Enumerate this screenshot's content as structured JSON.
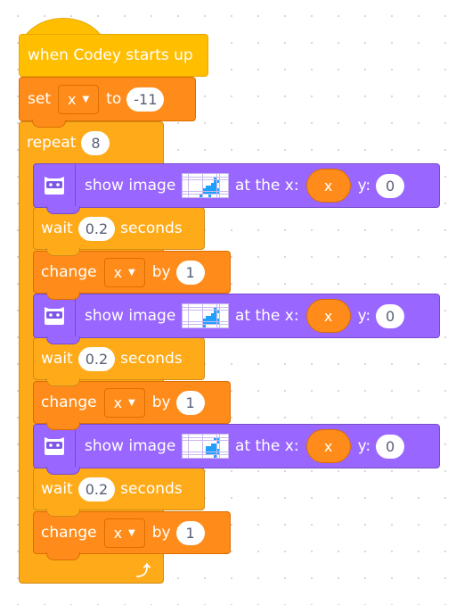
{
  "hat": {
    "label": "when Codey starts up"
  },
  "set_block": {
    "label": "set",
    "variable": "x",
    "to_label": "to",
    "value": "-11"
  },
  "repeat_block": {
    "label": "repeat",
    "times": "8",
    "loop_icon": "loop-arrow-icon"
  },
  "colors": {
    "hat": "#ffbf00",
    "variables": "#ff8c1a",
    "control": "#ffab19",
    "looks": "#9966ff",
    "led_on": "#1fa0ff"
  },
  "body": [
    {
      "type": "show_image",
      "label": "show image",
      "x_label": "at the x:",
      "x_value": "x",
      "y_label": "y:",
      "y_value": "0",
      "image": [
        "0000000000000000",
        "0000000000010000",
        "0000000000011000",
        "0000000000110000",
        "0000000011110000",
        "0000000111111000",
        "0000000111111000",
        "0000001001000000"
      ]
    },
    {
      "type": "wait",
      "label": "wait",
      "value": "0.2",
      "suffix": "seconds"
    },
    {
      "type": "change",
      "label": "change",
      "variable": "x",
      "by_label": "by",
      "value": "1"
    },
    {
      "type": "show_image",
      "label": "show image",
      "x_label": "at the x:",
      "x_value": "x",
      "y_label": "y:",
      "y_value": "0",
      "image": [
        "0000000000000000",
        "0000000000010000",
        "0000000000011000",
        "0000000000110000",
        "0000000011110000",
        "0000000111111000",
        "0000000111111000",
        "0000000100000000"
      ]
    },
    {
      "type": "wait",
      "label": "wait",
      "value": "0.2",
      "suffix": "seconds"
    },
    {
      "type": "change",
      "label": "change",
      "variable": "x",
      "by_label": "by",
      "value": "1"
    },
    {
      "type": "show_image",
      "label": "show image",
      "x_label": "at the x:",
      "x_value": "x",
      "y_label": "y:",
      "y_value": "0",
      "image": [
        "0000000000000000",
        "0000000000011000",
        "0000000000001000",
        "0000000000110000",
        "0000000011110000",
        "0000000011111000",
        "0000000011111000",
        "0000000000010000"
      ]
    },
    {
      "type": "wait",
      "label": "wait",
      "value": "0.2",
      "suffix": "seconds"
    },
    {
      "type": "change",
      "label": "change",
      "variable": "x",
      "by_label": "by",
      "value": "1"
    }
  ]
}
